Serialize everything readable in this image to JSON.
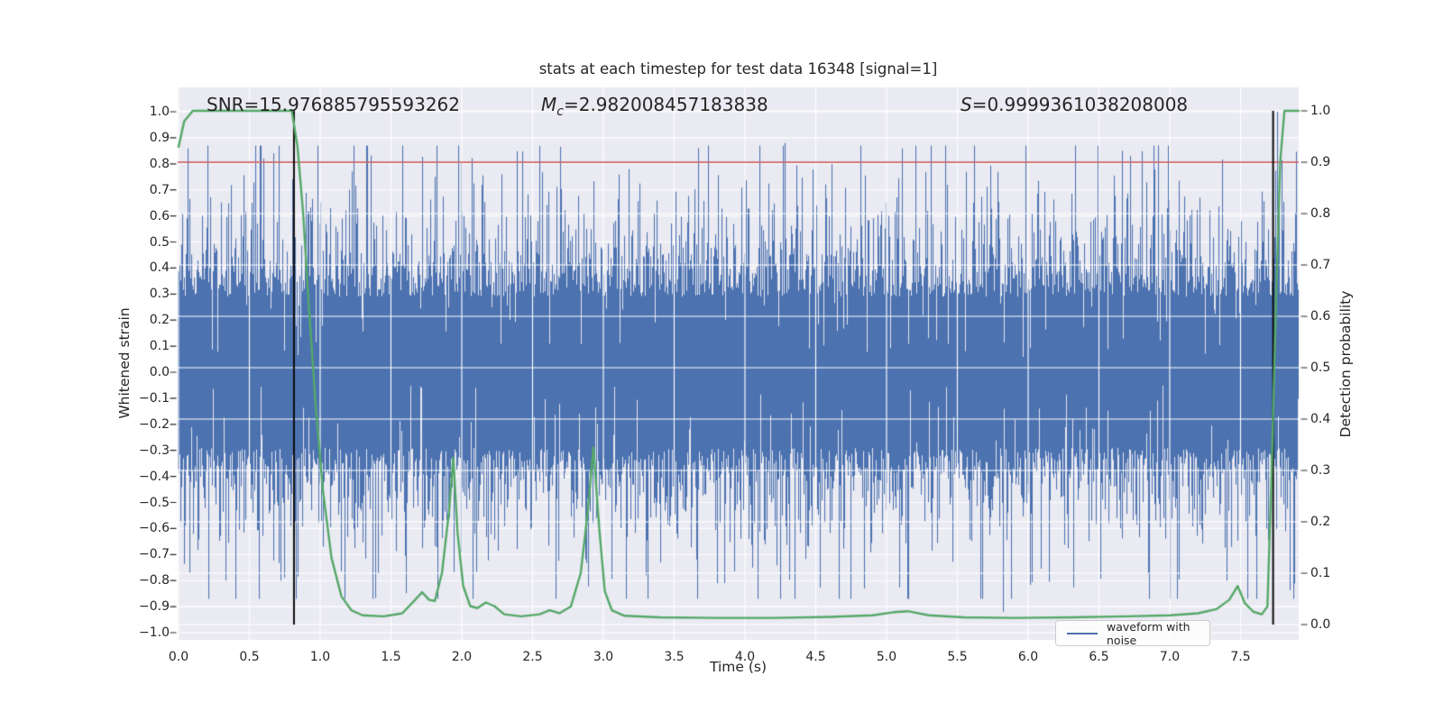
{
  "figure": {
    "title": "stats at each timestep for test data 16348 [signal=1]",
    "background": "#ffffff",
    "plot_background": "#eaeaf2",
    "text_color": "#262626"
  },
  "annotations": {
    "snr": "SNR=15.976885795593262",
    "mc_prefix": "M",
    "mc_sub": "c",
    "mc_rest": "=2.982008457183838",
    "s_prefix": "S",
    "s_rest": "=0.9999361038208008"
  },
  "legend": {
    "label": "waveform with noise",
    "line_color": "#4c72b0"
  },
  "chart_data": {
    "type": "line",
    "title": "stats at each timestep for test data 16348 [signal=1]",
    "xlabel": "Time (s)",
    "ylabel_left": "Whitened strain",
    "ylabel_right": "Detection probability",
    "xlim": [
      0.0,
      7.91
    ],
    "ylim_left": [
      -1.05,
      1.09
    ],
    "ylim_right": [
      -0.02,
      1.02
    ],
    "grid": {
      "color": "#ffffff",
      "x_step": 0.5,
      "left_step": 0.1,
      "right_step": 0.1
    },
    "x_ticks": [
      "0.0",
      "0.5",
      "1.0",
      "1.5",
      "2.0",
      "2.5",
      "3.0",
      "3.5",
      "4.0",
      "4.5",
      "5.0",
      "5.5",
      "6.0",
      "6.5",
      "7.0",
      "7.5"
    ],
    "left_ticks": [
      "1.0",
      "0.9",
      "0.8",
      "0.7",
      "0.6",
      "0.5",
      "0.4",
      "0.3",
      "0.2",
      "0.1",
      "0.0",
      "−0.1",
      "−0.2",
      "−0.3",
      "−0.4",
      "−0.5",
      "−0.6",
      "−0.7",
      "−0.8",
      "−0.9",
      "−1.0"
    ],
    "right_ticks": [
      "1.0",
      "0.9",
      "0.8",
      "0.7",
      "0.6",
      "0.5",
      "0.4",
      "0.3",
      "0.2",
      "0.1",
      "0.0"
    ],
    "series": [
      {
        "name": "waveform with noise",
        "type": "noise_band",
        "axis": "left",
        "color": "#4c72b0",
        "seed": 11,
        "core_amplitude": 0.29,
        "tail_scale": 0.155,
        "tail_cap": 0.58,
        "peak_clamp": 0.9,
        "shallow_prob": 0.055,
        "extreme_peaks": [
          [
            2.28,
            0.76
          ],
          [
            3.18,
            0.78
          ],
          [
            3.67,
            0.86
          ],
          [
            4.28,
            0.88
          ],
          [
            6.72,
            0.83
          ],
          [
            7.76,
            1.0
          ]
        ],
        "extreme_dips": [
          [
            0.33,
            -0.8
          ],
          [
            0.72,
            -0.8
          ],
          [
            3.3,
            -0.78
          ],
          [
            4.05,
            -0.75
          ],
          [
            4.84,
            -0.83
          ],
          [
            5.82,
            -0.92
          ],
          [
            7.4,
            -0.8
          ]
        ]
      },
      {
        "name": "detection probability",
        "type": "line",
        "axis": "right",
        "color": "#55a868",
        "points": [
          [
            0.0,
            0.93
          ],
          [
            0.04,
            0.98
          ],
          [
            0.1,
            1.0
          ],
          [
            0.8,
            1.0
          ],
          [
            0.84,
            0.93
          ],
          [
            0.88,
            0.8
          ],
          [
            0.92,
            0.62
          ],
          [
            0.97,
            0.42
          ],
          [
            1.02,
            0.26
          ],
          [
            1.08,
            0.13
          ],
          [
            1.15,
            0.055
          ],
          [
            1.22,
            0.028
          ],
          [
            1.3,
            0.018
          ],
          [
            1.45,
            0.016
          ],
          [
            1.58,
            0.022
          ],
          [
            1.66,
            0.045
          ],
          [
            1.72,
            0.063
          ],
          [
            1.77,
            0.048
          ],
          [
            1.81,
            0.046
          ],
          [
            1.86,
            0.1
          ],
          [
            1.91,
            0.22
          ],
          [
            1.94,
            0.325
          ],
          [
            1.97,
            0.18
          ],
          [
            2.01,
            0.075
          ],
          [
            2.06,
            0.036
          ],
          [
            2.11,
            0.032
          ],
          [
            2.17,
            0.043
          ],
          [
            2.23,
            0.036
          ],
          [
            2.3,
            0.02
          ],
          [
            2.42,
            0.016
          ],
          [
            2.55,
            0.02
          ],
          [
            2.62,
            0.028
          ],
          [
            2.69,
            0.022
          ],
          [
            2.77,
            0.035
          ],
          [
            2.84,
            0.1
          ],
          [
            2.89,
            0.22
          ],
          [
            2.93,
            0.345
          ],
          [
            2.97,
            0.19
          ],
          [
            3.01,
            0.065
          ],
          [
            3.06,
            0.028
          ],
          [
            3.15,
            0.017
          ],
          [
            3.4,
            0.014
          ],
          [
            3.8,
            0.013
          ],
          [
            4.2,
            0.013
          ],
          [
            4.6,
            0.015
          ],
          [
            4.9,
            0.018
          ],
          [
            5.05,
            0.024
          ],
          [
            5.15,
            0.026
          ],
          [
            5.3,
            0.018
          ],
          [
            5.55,
            0.014
          ],
          [
            5.9,
            0.013
          ],
          [
            6.3,
            0.014
          ],
          [
            6.7,
            0.016
          ],
          [
            7.0,
            0.018
          ],
          [
            7.2,
            0.022
          ],
          [
            7.33,
            0.03
          ],
          [
            7.42,
            0.048
          ],
          [
            7.48,
            0.075
          ],
          [
            7.53,
            0.042
          ],
          [
            7.59,
            0.025
          ],
          [
            7.65,
            0.02
          ],
          [
            7.69,
            0.035
          ],
          [
            7.72,
            0.3
          ],
          [
            7.75,
            0.62
          ],
          [
            7.78,
            0.9
          ],
          [
            7.81,
            1.0
          ],
          [
            7.91,
            1.0
          ]
        ]
      },
      {
        "name": "threshold",
        "type": "hline",
        "axis": "right",
        "color": "#c44e52",
        "y": 0.9
      },
      {
        "name": "event markers",
        "type": "vlines",
        "axis": "right",
        "color": "#0d0d0d",
        "x": [
          0.815,
          7.73
        ],
        "span": [
          0.0,
          1.0
        ]
      }
    ],
    "legend": {
      "labels": [
        "waveform with noise"
      ],
      "position": "lower right"
    }
  }
}
